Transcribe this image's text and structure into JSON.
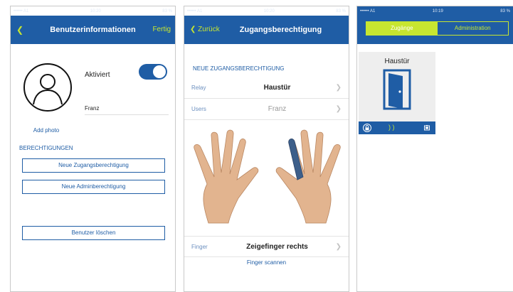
{
  "colors": {
    "primary": "#1f5da5",
    "accent": "#c7e630"
  },
  "phone1": {
    "status": {
      "carrier": "•••••• A1",
      "time": "10:20",
      "battery": "83 %"
    },
    "nav": {
      "back_icon": "chevron-left-icon",
      "title": "Benutzerinformationen",
      "done": "Fertig"
    },
    "add_photo": "Add photo",
    "aktiviert": "Aktiviert",
    "toggle_on": true,
    "name": "Franz",
    "section_label": "BERECHTIGUNGEN",
    "buttons": {
      "new_access": "Neue Zugangsberechtigung",
      "new_admin": "Neue Adminberechtigung",
      "delete_user": "Benutzer löschen"
    }
  },
  "phone2": {
    "status": {
      "carrier": "•••••• A1",
      "time": "10:20",
      "battery": "83 %"
    },
    "nav": {
      "back": "Zurück",
      "title": "Zugangsberechtigung"
    },
    "section_label": "NEUE ZUGANGSBERECHTIGUNG",
    "rows": [
      {
        "label": "Relay",
        "value": "Haustür"
      },
      {
        "label": "Users",
        "value": "Franz"
      },
      {
        "label": "Finger",
        "value": "Zeigefinger rechts"
      }
    ],
    "scan": "Finger scannen"
  },
  "phone3": {
    "status": {
      "carrier": "•••••• A1",
      "time": "10:19",
      "battery": "83 %"
    },
    "tabs": [
      "Zugänge",
      "Administration"
    ],
    "tile": {
      "name": "Haustür",
      "icons": [
        "lock-icon",
        "signal-icon",
        "battery-icon"
      ]
    }
  }
}
